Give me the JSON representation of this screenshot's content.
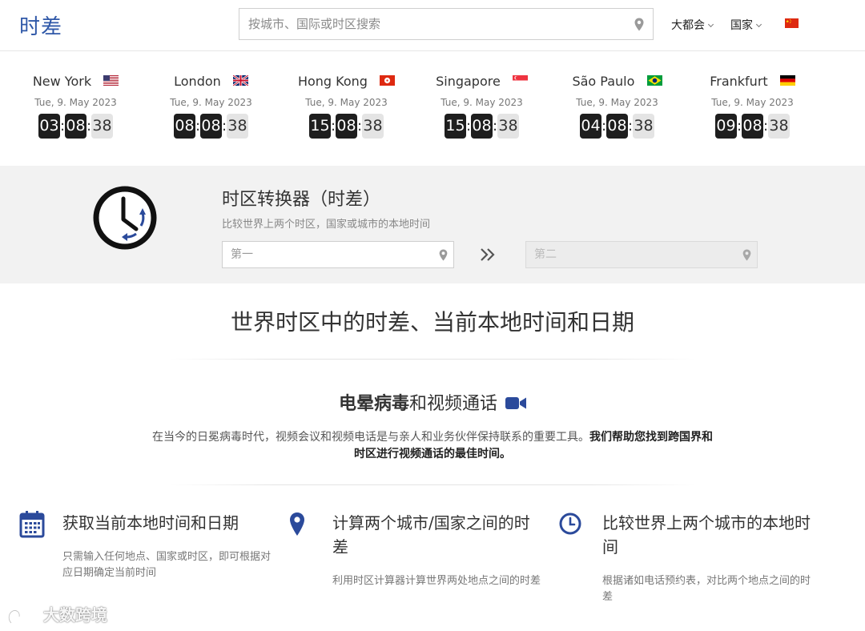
{
  "header": {
    "logo": "时差",
    "search_placeholder": "按城市、国际或时区搜索",
    "nav": [
      {
        "label": "大都会"
      },
      {
        "label": "国家"
      }
    ],
    "language_flag": "cn"
  },
  "clocks": [
    {
      "city": "New York",
      "flag": "us",
      "date": "Tue, 9. May 2023",
      "hour": "03",
      "minute": "08",
      "second": "38"
    },
    {
      "city": "London",
      "flag": "gb",
      "date": "Tue, 9. May 2023",
      "hour": "08",
      "minute": "08",
      "second": "38"
    },
    {
      "city": "Hong Kong",
      "flag": "hk",
      "date": "Tue, 9. May 2023",
      "hour": "15",
      "minute": "08",
      "second": "38"
    },
    {
      "city": "Singapore",
      "flag": "sg",
      "date": "Tue, 9. May 2023",
      "hour": "15",
      "minute": "08",
      "second": "38"
    },
    {
      "city": "São Paulo",
      "flag": "br",
      "date": "Tue, 9. May 2023",
      "hour": "04",
      "minute": "08",
      "second": "38"
    },
    {
      "city": "Frankfurt",
      "flag": "de",
      "date": "Tue, 9. May 2023",
      "hour": "09",
      "minute": "08",
      "second": "38"
    }
  ],
  "converter": {
    "title": "时区转换器（时差）",
    "subtitle": "比较世界上两个时区，国家或城市的本地时间",
    "first_placeholder": "第一",
    "second_placeholder": "第二"
  },
  "main": {
    "headline": "世界时区中的时差、当前本地时间和日期",
    "section_bold": "电晕病毒",
    "section_rest": "和视频通话",
    "para_normal": "在当今的日冕病毒时代，视频会议和视频电话是与亲人和业务伙伴保持联系的重要工具。",
    "para_bold": "我们帮助您找到跨国界和时区进行视频通话的最佳时间。"
  },
  "features": [
    {
      "title": "获取当前本地时间和日期",
      "desc": "只需输入任何地点、国家或时区，即可根据对应日期确定当前时间",
      "icon": "calendar-icon"
    },
    {
      "title": "计算两个城市/国家之间的时差",
      "desc": "利用时区计算器计算世界两处地点之间的时差",
      "icon": "map-pin-icon"
    },
    {
      "title": "比较世界上两个城市的本地时间",
      "desc": "根据诸如电话预约表，对比两个地点之间的时差",
      "icon": "clock-icon"
    }
  ],
  "watermark": "大数跨境",
  "colors": {
    "brand_blue": "#2f58a8",
    "icon_blue": "#2b4a9b",
    "digit_dark": "#1e1e1e",
    "digit_light": "#e4e4e4",
    "band_gray": "#f2f2f2"
  }
}
